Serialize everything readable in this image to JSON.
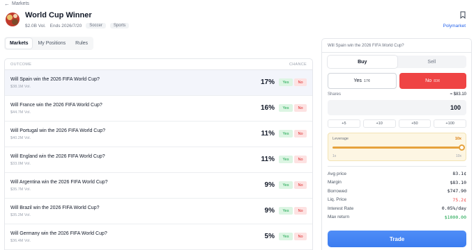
{
  "nav": {
    "back_label": "Markets"
  },
  "header": {
    "title": "World Cup Winner",
    "volume": "$2.0B Vol.",
    "ends": "Ends 2026/7/20",
    "tags": [
      "Soccer",
      "Sports"
    ],
    "source_link": "Polymarket"
  },
  "tabs": [
    {
      "label": "Markets",
      "active": true
    },
    {
      "label": "My Positions",
      "active": false
    },
    {
      "label": "Rules",
      "active": false
    }
  ],
  "outcomes": {
    "col_outcome": "OUTCOME",
    "col_chance": "CHANCE",
    "rows": [
      {
        "question": "Will Spain win the 2026 FIFA World Cup?",
        "volume": "$38.1M Vol.",
        "chance": "17%",
        "yes": "Yes",
        "no": "No",
        "selected": true
      },
      {
        "question": "Will France win the 2026 FIFA World Cup?",
        "volume": "$44.7M Vol.",
        "chance": "16%",
        "yes": "Yes",
        "no": "No"
      },
      {
        "question": "Will Portugal win the 2026 FIFA World Cup?",
        "volume": "$40.2M Vol.",
        "chance": "11%",
        "yes": "Yes",
        "no": "No"
      },
      {
        "question": "Will England win the 2026 FIFA World Cup?",
        "volume": "$33.0M Vol.",
        "chance": "11%",
        "yes": "Yes",
        "no": "No"
      },
      {
        "question": "Will Argentina win the 2026 FIFA World Cup?",
        "volume": "$35.7M Vol.",
        "chance": "9%",
        "yes": "Yes",
        "no": "No"
      },
      {
        "question": "Will Brazil win the 2026 FIFA World Cup?",
        "volume": "$35.2M Vol.",
        "chance": "9%",
        "yes": "Yes",
        "no": "No"
      },
      {
        "question": "Will Germany win the 2026 FIFA World Cup?",
        "volume": "$36.4M Vol.",
        "chance": "5%",
        "yes": "Yes",
        "no": "No"
      }
    ]
  },
  "trade_panel": {
    "question": "Will Spain win the 2026 FIFA World Cup?",
    "buy_label": "Buy",
    "sell_label": "Sell",
    "yes_label": "Yes",
    "yes_price": "17¢",
    "no_label": "No",
    "no_price": "83¢",
    "shares_label": "Shares",
    "shares_cost": "≈ $83.10",
    "shares_value": "100",
    "quick_adds": [
      "+5",
      "+10",
      "+50",
      "+100"
    ],
    "leverage_label": "Leverage",
    "leverage_value": "10x",
    "leverage_min": "1x",
    "leverage_max": "10x",
    "leverage_level_fraction": 1.0,
    "stats": [
      {
        "label": "Avg price",
        "value": "83.1¢",
        "tone": "normal"
      },
      {
        "label": "Margin",
        "value": "$83.10",
        "tone": "normal"
      },
      {
        "label": "Borrowed",
        "value": "$747.90",
        "tone": "normal"
      },
      {
        "label": "Liq. Price",
        "value": "75.2¢",
        "tone": "red"
      },
      {
        "label": "Interest Rate",
        "value": "0.05%/day",
        "tone": "normal"
      },
      {
        "label": "Max return",
        "value": "$1000.00",
        "tone": "green"
      }
    ],
    "trade_label": "Trade"
  },
  "colors": {
    "accent_blue": "#3b7cf0",
    "no_red": "#ef4444",
    "yes_green": "#16a34a",
    "leverage_amber": "#e6a23c"
  }
}
